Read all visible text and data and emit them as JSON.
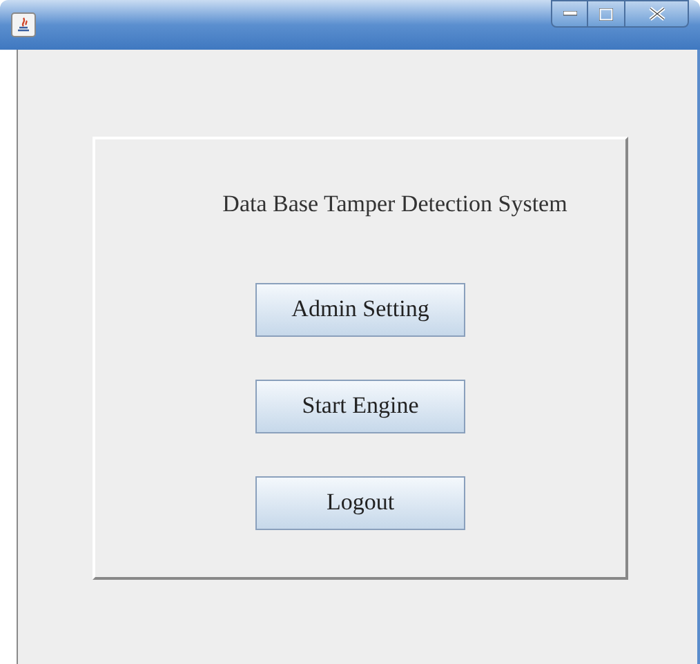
{
  "heading": "Data Base Tamper Detection System",
  "buttons": [
    "Admin Setting",
    "Start Engine",
    "Logout"
  ]
}
